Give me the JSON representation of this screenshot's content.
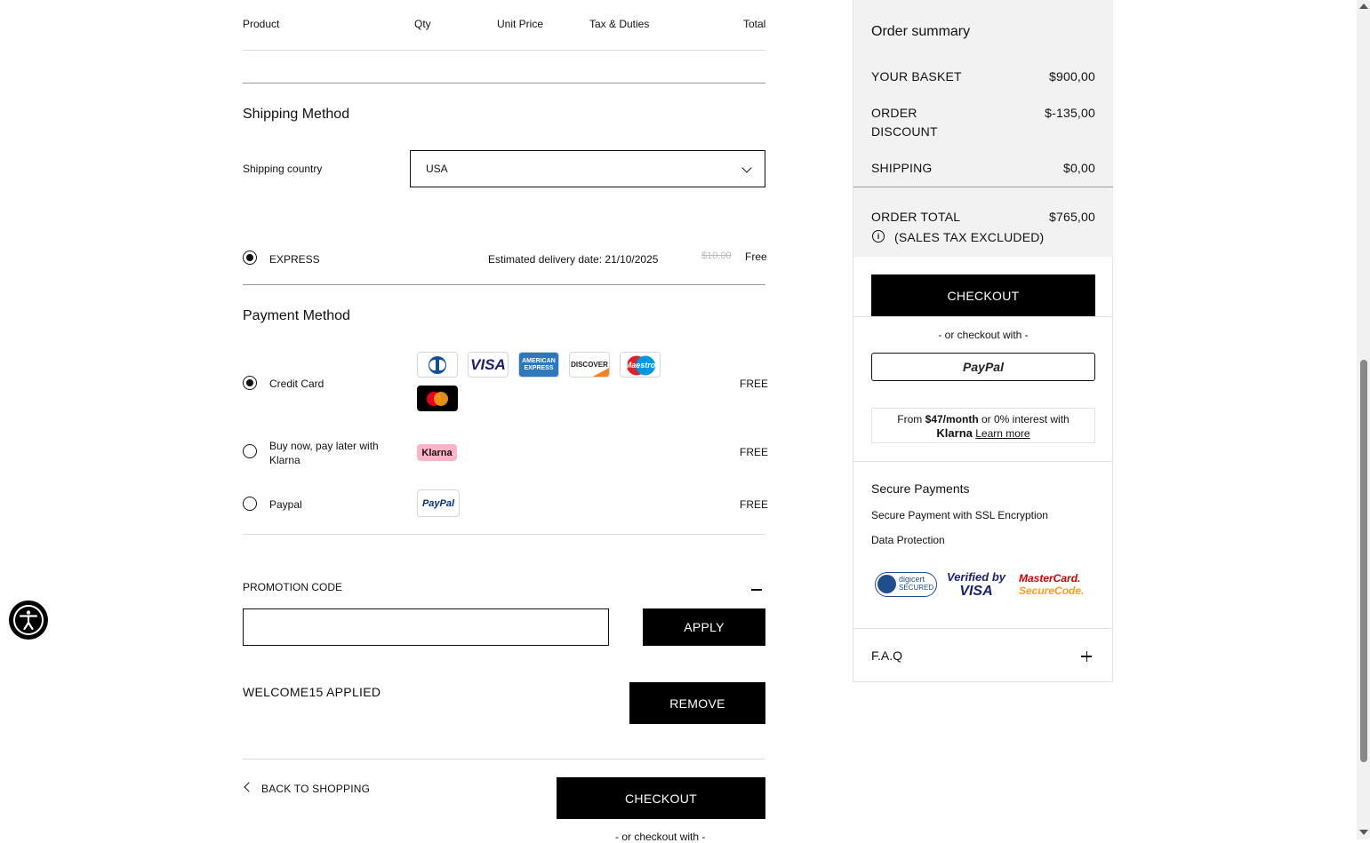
{
  "table_header": {
    "product": "Product",
    "qty": "Qty",
    "unit_price": "Unit Price",
    "tax_duties": "Tax & Duties",
    "total": "Total"
  },
  "shipping": {
    "title": "Shipping Method",
    "country_label": "Shipping country",
    "country_value": "USA",
    "option_label": "EXPRESS",
    "delivery_text": "Estimated delivery date: 21/10/2025",
    "old_price": "$10,00",
    "price": "Free"
  },
  "payment": {
    "title": "Payment Method",
    "options": [
      {
        "label": "Credit Card",
        "price": "FREE",
        "selected": true
      },
      {
        "label": "Buy now, pay later with Klarna",
        "price": "FREE",
        "selected": false
      },
      {
        "label": "Paypal",
        "price": "FREE",
        "selected": false
      }
    ],
    "logos": {
      "visa": "VISA",
      "amex_1": "AMERICAN",
      "amex_2": "EXPRESS",
      "discover": "DISCOVER",
      "maestro": "Maestro",
      "klarna": "Klarna",
      "paypal": "PayPal"
    }
  },
  "promo": {
    "label": "PROMOTION CODE",
    "input_value": "",
    "apply_label": "APPLY",
    "applied_text": "WELCOME15 APPLIED",
    "remove_label": "REMOVE"
  },
  "footer": {
    "back_label": "BACK TO SHOPPING",
    "checkout_label": "CHECKOUT",
    "or_checkout": "- or checkout with -"
  },
  "summary": {
    "title": "Order summary",
    "basket_label": "YOUR BASKET",
    "basket_value": "$900,00",
    "discount_label_1": "ORDER",
    "discount_label_2": "DISCOUNT",
    "discount_value": "$-135,00",
    "shipping_label": "SHIPPING",
    "shipping_value": "$0,00",
    "total_label": "ORDER TOTAL",
    "total_value": "$765,00",
    "tax_note": "(SALES TAX EXCLUDED)",
    "checkout_label": "CHECKOUT",
    "or_checkout": "- or checkout with -",
    "paypal_label": "PayPal",
    "klarna_pre": "From ",
    "klarna_amount": "$47/month",
    "klarna_post": " or 0% interest with",
    "klarna_brand": "Klarna",
    "klarna_link": "Learn more",
    "secure_title": "Secure Payments",
    "secure_1": "Secure Payment with SSL Encryption",
    "secure_2": "Data Protection",
    "badge_digicert_1": "digicert",
    "badge_digicert_2": "SECURED",
    "badge_visa_1": "Verified by",
    "badge_visa_2": "VISA",
    "badge_mc_1": "MasterCard.",
    "badge_mc_2": "SecureCode.",
    "faq_label": "F.A.Q"
  },
  "colors": {
    "accent": "#000000",
    "sidebar_bg": "#f2f2f2",
    "klarna_pink": "#ffb3c7",
    "amex_blue": "#2e77bb",
    "discover_orange": "#f58220",
    "mastercard_red": "#eb001b",
    "mastercard_yellow": "#f79e1b"
  }
}
